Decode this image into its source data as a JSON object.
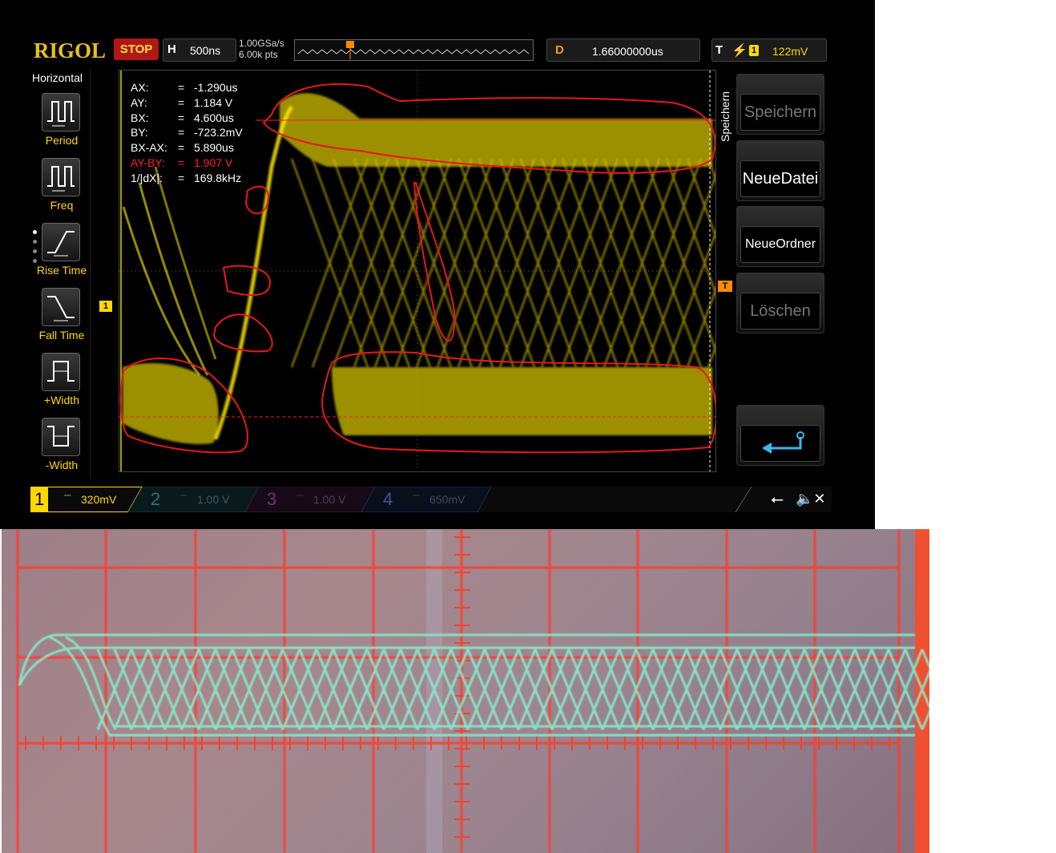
{
  "scope": {
    "brand": "RIGOL",
    "run_state": "STOP",
    "timebase": {
      "key": "H",
      "value": "500ns"
    },
    "sample_rate": "1.00GSa/s",
    "memory_depth": "6.00k pts",
    "delay": {
      "key": "D",
      "value": "1.66000000us"
    },
    "trigger": {
      "key": "T",
      "source": "1",
      "level": "122mV"
    },
    "left_menu": {
      "title": "Horizontal",
      "items": [
        {
          "label": "Period",
          "icon": "period-icon"
        },
        {
          "label": "Freq",
          "icon": "frequency-icon"
        },
        {
          "label": "Rise Time",
          "icon": "rise-time-icon"
        },
        {
          "label": "Fall Time",
          "icon": "fall-time-icon"
        },
        {
          "label": "+Width",
          "icon": "positive-width-icon"
        },
        {
          "label": "-Width",
          "icon": "negative-width-icon"
        }
      ]
    },
    "cursor_readout": [
      {
        "key": "AX:",
        "eq": "=",
        "value": "-1.290us"
      },
      {
        "key": "AY:",
        "eq": "=",
        "value": "1.184 V"
      },
      {
        "key": "BX:",
        "eq": "=",
        "value": "4.600us"
      },
      {
        "key": "BY:",
        "eq": "=",
        "value": "-723.2mV"
      },
      {
        "key": "BX-AX:",
        "eq": "=",
        "value": "5.890us"
      },
      {
        "key": "AY-BY:",
        "eq": "=",
        "value": "1.907 V"
      },
      {
        "key": "1/|dX|:",
        "eq": "=",
        "value": "169.8kHz"
      }
    ],
    "markers": {
      "channel": "1",
      "trigger": "T"
    },
    "right_menu": {
      "title": "Speichern",
      "buttons": [
        "Speichern",
        "NeueDatei",
        "NeueOrdner",
        "Löschen"
      ],
      "back_icon": "return-arrow-icon"
    },
    "channels": [
      {
        "num": "1",
        "coupling": "⎓",
        "scale": "320mV",
        "color": "#ffd800"
      },
      {
        "num": "2",
        "coupling": "⎓",
        "scale": "1.00 V",
        "color": "#2f6f78"
      },
      {
        "num": "3",
        "coupling": "⎓",
        "scale": "1.00 V",
        "color": "#7a2f7a"
      },
      {
        "num": "4",
        "coupling": "⎓",
        "scale": "650mV",
        "color": "#2f4f8f"
      }
    ],
    "status_icons": [
      "usb-icon",
      "speaker-muted-icon"
    ],
    "colors": {
      "trace": "#e0d000",
      "annotation": "#e01818",
      "stop": "#b01818",
      "delay_key": "#ff9a1a"
    }
  },
  "photo": {
    "description_icon": "analog-oscilloscope-photo",
    "colors": {
      "graticule": "#ff3a2a",
      "trace": "#7fe8c8",
      "background": "#9d8089"
    }
  }
}
